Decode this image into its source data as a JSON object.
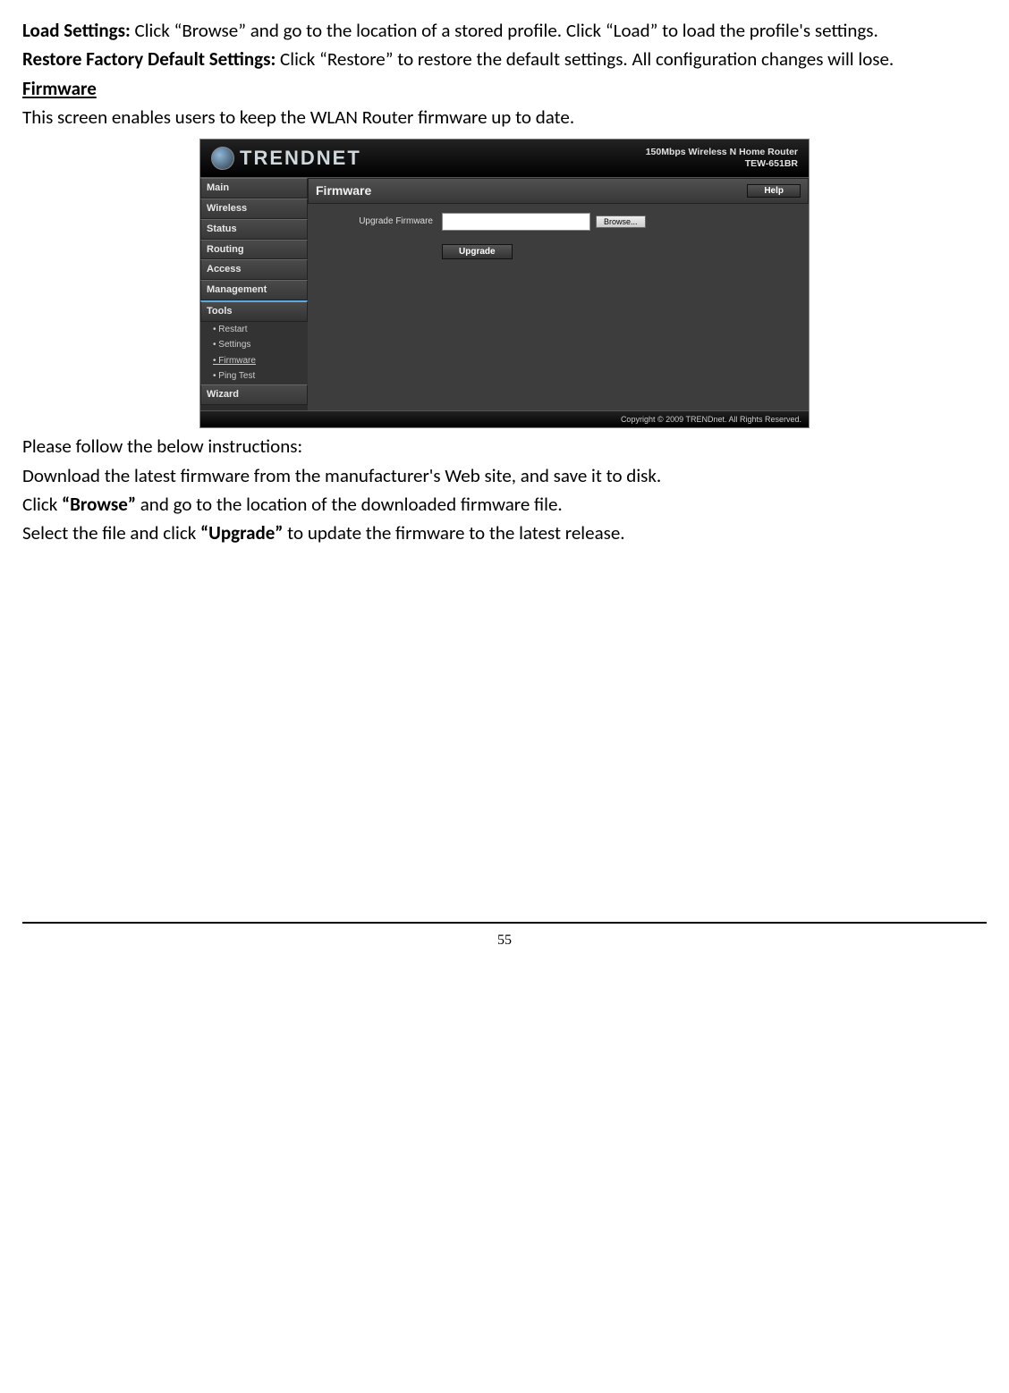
{
  "doc": {
    "load_settings_label": "Load Settings: ",
    "load_settings_text": "Click “Browse” and go to the location of a stored profile. Click “Load” to load the profile's settings.",
    "restore_label": "Restore Factory Default Settings: ",
    "restore_text": "Click “Restore” to restore the default settings. All configuration changes will lose.",
    "firmware_heading": "Firmware",
    "firmware_intro": "This screen enables users to keep the WLAN Router firmware up to date.",
    "instructions_intro": "Please follow the below instructions:",
    "instr1": "Download the latest firmware from the manufacturer's Web site, and save it to disk.",
    "instr2_pre": "Click ",
    "instr2_bold": "“Browse”",
    "instr2_post": " and go to the location of the downloaded firmware file.",
    "instr3_pre": "Select the file and click ",
    "instr3_bold": "“Upgrade”",
    "instr3_post": " to update the firmware to the latest release.",
    "page_number": "55"
  },
  "screenshot": {
    "brand": "TRENDNET",
    "product_line1": "150Mbps Wireless N Home Router",
    "product_line2": "TEW-651BR",
    "nav": {
      "main": "Main",
      "wireless": "Wireless",
      "status": "Status",
      "routing": "Routing",
      "access": "Access",
      "management": "Management",
      "tools": "Tools",
      "wizard": "Wizard"
    },
    "sub": {
      "restart": "• Restart",
      "settings": "• Settings",
      "firmware": "• Firmware",
      "ping": "• Ping Test"
    },
    "panel_title": "Firmware",
    "help_button": "Help",
    "form_label": "Upgrade Firmware",
    "browse_button": "Browse...",
    "upgrade_button": "Upgrade",
    "footer": "Copyright © 2009 TRENDnet. All Rights Reserved."
  }
}
